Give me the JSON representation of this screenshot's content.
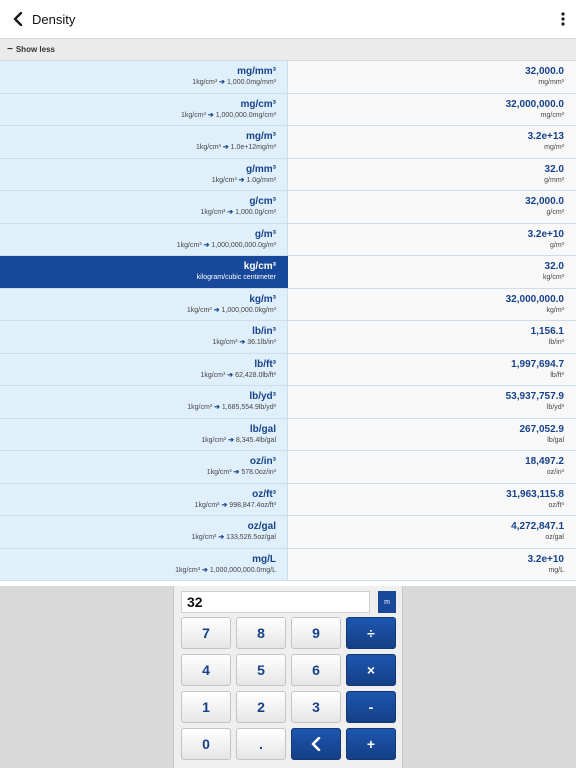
{
  "header": {
    "title": "Density"
  },
  "toggle": {
    "minus": "−",
    "label": "Show less"
  },
  "rows": [
    {
      "unit": "mg/mm³",
      "conv_from": "1kg/cm³",
      "conv_to": "1,000.0mg/mm³",
      "value": "32,000.0",
      "value_unit": "mg/mm³"
    },
    {
      "unit": "mg/cm³",
      "conv_from": "1kg/cm³",
      "conv_to": "1,000,000.0mg/cm³",
      "value": "32,000,000.0",
      "value_unit": "mg/cm³"
    },
    {
      "unit": "mg/m³",
      "conv_from": "1kg/cm³",
      "conv_to": "1.0e+12mg/m³",
      "value": "3.2e+13",
      "value_unit": "mg/m³"
    },
    {
      "unit": "g/mm³",
      "conv_from": "1kg/cm³",
      "conv_to": "1.0g/mm³",
      "value": "32.0",
      "value_unit": "g/mm³"
    },
    {
      "unit": "g/cm³",
      "conv_from": "1kg/cm³",
      "conv_to": "1,000.0g/cm³",
      "value": "32,000.0",
      "value_unit": "g/cm³"
    },
    {
      "unit": "g/m³",
      "conv_from": "1kg/cm³",
      "conv_to": "1,000,000,000.0g/m³",
      "value": "3.2e+10",
      "value_unit": "g/m³"
    },
    {
      "unit": "kg/cm³",
      "description": "kilogram/cubic centimeter",
      "value": "32.0",
      "value_unit": "kg/cm³",
      "selected": true
    },
    {
      "unit": "kg/m³",
      "conv_from": "1kg/cm³",
      "conv_to": "1,000,000.0kg/m³",
      "value": "32,000,000.0",
      "value_unit": "kg/m³"
    },
    {
      "unit": "lb/in³",
      "conv_from": "1kg/cm³",
      "conv_to": "36.1lb/in³",
      "value": "1,156.1",
      "value_unit": "lb/in³"
    },
    {
      "unit": "lb/ft³",
      "conv_from": "1kg/cm³",
      "conv_to": "62,428.0lb/ft³",
      "value": "1,997,694.7",
      "value_unit": "lb/ft³"
    },
    {
      "unit": "lb/yd³",
      "conv_from": "1kg/cm³",
      "conv_to": "1,685,554.9lb/yd³",
      "value": "53,937,757.9",
      "value_unit": "lb/yd³"
    },
    {
      "unit": "lb/gal",
      "conv_from": "1kg/cm³",
      "conv_to": "8,345.4lb/gal",
      "value": "267,052.9",
      "value_unit": "lb/gal"
    },
    {
      "unit": "oz/in³",
      "conv_from": "1kg/cm³",
      "conv_to": "578.0oz/in³",
      "value": "18,497.2",
      "value_unit": "oz/in³"
    },
    {
      "unit": "oz/ft³",
      "conv_from": "1kg/cm³",
      "conv_to": "998,847.4oz/ft³",
      "value": "31,963,115.8",
      "value_unit": "oz/ft³"
    },
    {
      "unit": "oz/gal",
      "conv_from": "1kg/cm³",
      "conv_to": "133,526.5oz/gal",
      "value": "4,272,847.1",
      "value_unit": "oz/gal"
    },
    {
      "unit": "mg/L",
      "conv_from": "1kg/cm³",
      "conv_to": "1,000,000,000.0mg/L",
      "value": "3.2e+10",
      "value_unit": "mg/L"
    }
  ],
  "keypad": {
    "display_value": "32",
    "mode_label": "m",
    "keys": {
      "k7": "7",
      "k8": "8",
      "k9": "9",
      "divide": "÷",
      "k4": "4",
      "k5": "5",
      "k6": "6",
      "multiply": "×",
      "k1": "1",
      "k2": "2",
      "k3": "3",
      "minus": "-",
      "k0": "0",
      "dot": ".",
      "plus": "+"
    }
  },
  "colors": {
    "accent": "#17489a",
    "row_left_bg": "#e0f0fb",
    "row_right_bg": "#f8f8f8"
  },
  "icons": {
    "back": "chevron-left-icon",
    "more": "more-vertical-icon",
    "backspace": "chevron-left-icon"
  }
}
